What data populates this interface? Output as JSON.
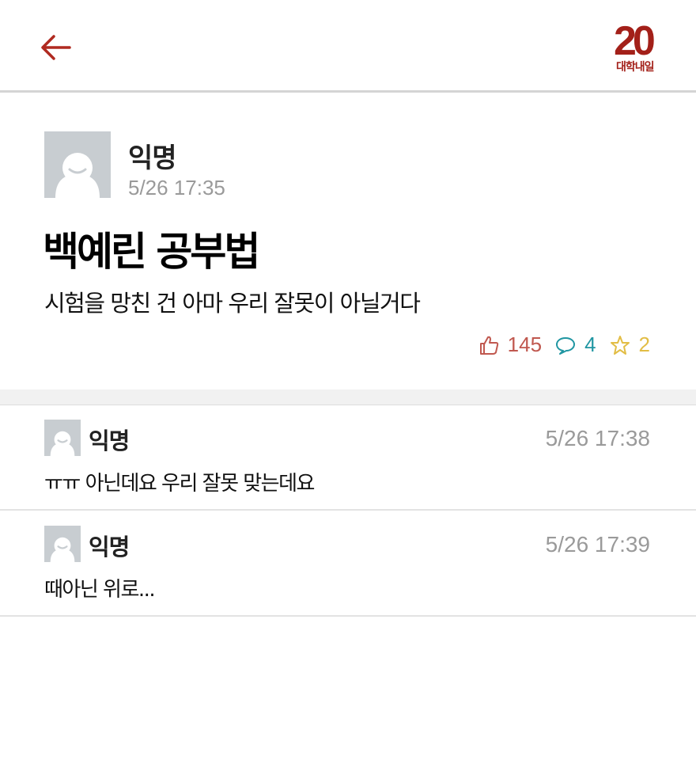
{
  "header": {
    "back_icon": "arrow-left-icon",
    "logo_number": "20",
    "logo_text": "대학내일",
    "accent_color": "#a32019"
  },
  "post": {
    "author": "익명",
    "timestamp": "5/26 17:35",
    "title": "백예린 공부법",
    "body": "시험을 망친 건 아마 우리 잘못이 아닐거다",
    "stats": {
      "likes": "145",
      "comments": "4",
      "scraps": "2"
    }
  },
  "comments": [
    {
      "author": "익명",
      "timestamp": "5/26 17:38",
      "body": "ㅠㅠ 아닌데요 우리 잘못 맞는데요"
    },
    {
      "author": "익명",
      "timestamp": "5/26 17:39",
      "body": "때아닌 위로..."
    }
  ],
  "colors": {
    "like": "#c0584f",
    "comment": "#2096a2",
    "scrap": "#e2bd45",
    "muted": "#9a9a9a"
  }
}
